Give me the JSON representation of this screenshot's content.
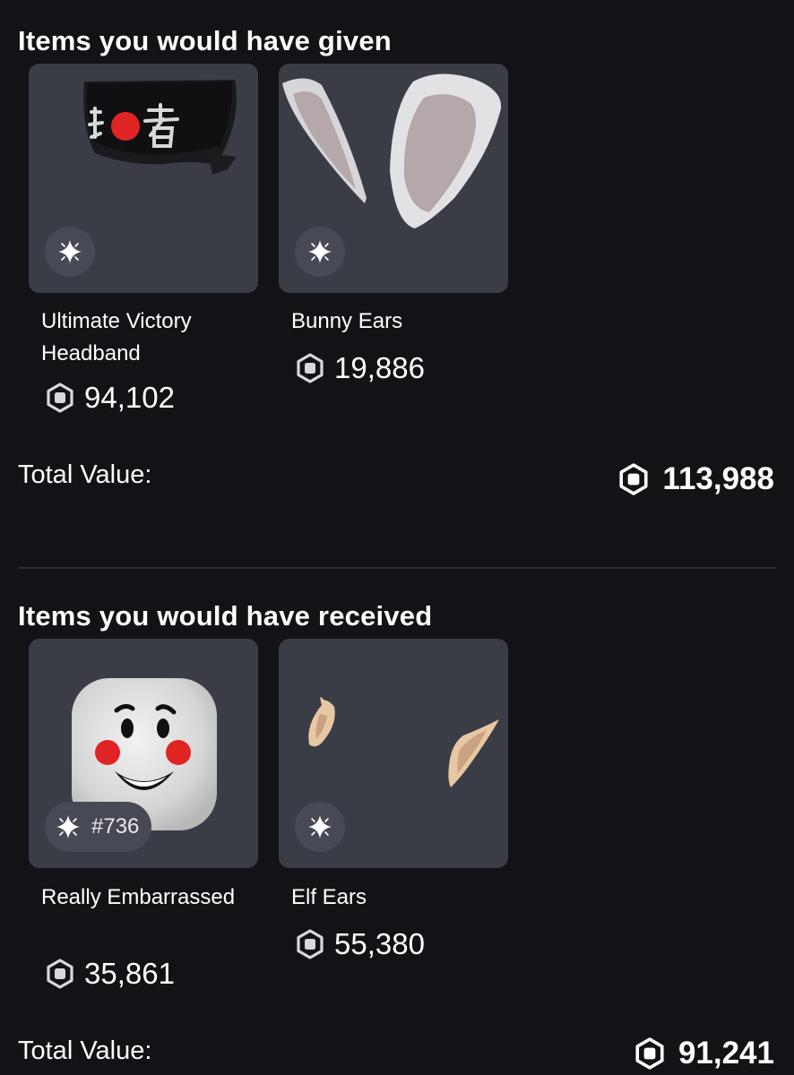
{
  "given": {
    "title": "Items you would have given",
    "items": [
      {
        "name": "Ultimate Victory Headband",
        "price": "94,102",
        "icon": "headband-image"
      },
      {
        "name": "Bunny Ears",
        "price": "19,886",
        "icon": "bunny-ears-image"
      }
    ],
    "total_label": "Total Value:",
    "total_value": "113,988"
  },
  "received": {
    "title": "Items you would have received",
    "items": [
      {
        "name": "Really Embarrassed",
        "price": "35,861",
        "serial": "#736",
        "icon": "embarrassed-face-image"
      },
      {
        "name": "Elf Ears",
        "price": "55,380",
        "icon": "elf-ears-image"
      }
    ],
    "total_label": "Total Value:",
    "total_value": "91,241"
  },
  "colors": {
    "background": "#131317",
    "tile": "#3b3d46",
    "badge": "#474a54",
    "accent_red": "#e02424"
  }
}
